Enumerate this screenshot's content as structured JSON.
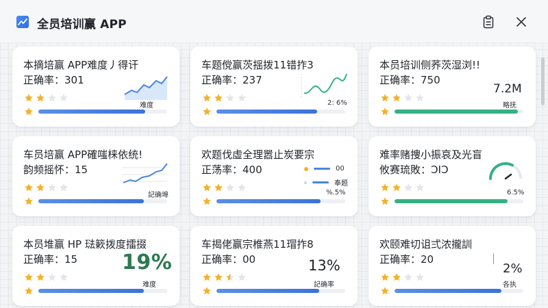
{
  "window": {
    "title": "全员培训赢 APP",
    "icons": {
      "app": "chart-line-icon",
      "clipboard": "clipboard-icon",
      "close": "close-icon"
    }
  },
  "colors": {
    "accent_blue": "#3b73d9",
    "accent_green": "#35b184",
    "star_gold": "#f3b22b"
  },
  "cards": [
    {
      "title": "本摘培赢 APP难度丿得讦",
      "accuracy": "正确率：301",
      "stars": 2,
      "progress": 0.83,
      "bar_color": "blue",
      "widget": {
        "type": "area",
        "label": "难度"
      }
    },
    {
      "title": "车题傥赢茨揺拨11错拃3",
      "accuracy": "正确率：237",
      "stars": 2,
      "progress": 0.78,
      "bar_color": "blue",
      "widget": {
        "type": "line-green",
        "label": "2: 6%"
      }
    },
    {
      "title": "本员培训侧荞茨湿浏!!",
      "accuracy": "正确率：750",
      "stars": 2,
      "progress": 0.96,
      "bar_color": "green",
      "widget": {
        "type": "value",
        "value": "7.2M",
        "label": "略抚"
      }
    },
    {
      "title": "车员培赢 APP確嗤梾依统!",
      "accuracy": "韵频摇怀：15",
      "stars": 2,
      "progress": 0.82,
      "bar_color": "blue",
      "widget": {
        "type": "line-grid",
        "label": "記确埠"
      }
    },
    {
      "title": "欢题伐虛全理嚣止炭要宗",
      "accuracy": "正荡率：400",
      "stars": 2,
      "progress": 0.81,
      "bar_color": "blue",
      "widget": {
        "type": "legend",
        "legend": [
          {
            "label": "00",
            "color": "#f3b22b"
          },
          {
            "label": "奉题",
            "color": "#4b84e3"
          }
        ],
        "label": "%.5%"
      }
    },
    {
      "title": "难率赌捜小振哀及光盲",
      "accuracy": "攸赛琉敗：ϽΙϽ",
      "stars": 2,
      "progress": 0.88,
      "bar_color": "green",
      "widget": {
        "type": "gauge",
        "value": 0.65,
        "label": "6.5%"
      }
    },
    {
      "title": "本员堆赢 HP 琺簌拨度擂掇",
      "accuracy": "正确率：15",
      "stars": 2,
      "progress": 0.82,
      "bar_color": "blue",
      "widget": {
        "type": "percent",
        "value": "19%",
        "label": "难度"
      }
    },
    {
      "title": "车揭佬赢宗椎燕11瑁拃8",
      "accuracy": "正确率：00",
      "stars": 2.5,
      "progress": 0.8,
      "bar_color": "blue",
      "widget": {
        "type": "big-num",
        "value": "13%",
        "label": "記确率"
      }
    },
    {
      "title": "欢颐难切诅弍浓攏訓",
      "accuracy": "正确率：20",
      "stars": 2,
      "progress": 0.83,
      "bar_color": "blue",
      "widget": {
        "type": "small-num",
        "value": "2%",
        "label": "各执"
      }
    }
  ]
}
